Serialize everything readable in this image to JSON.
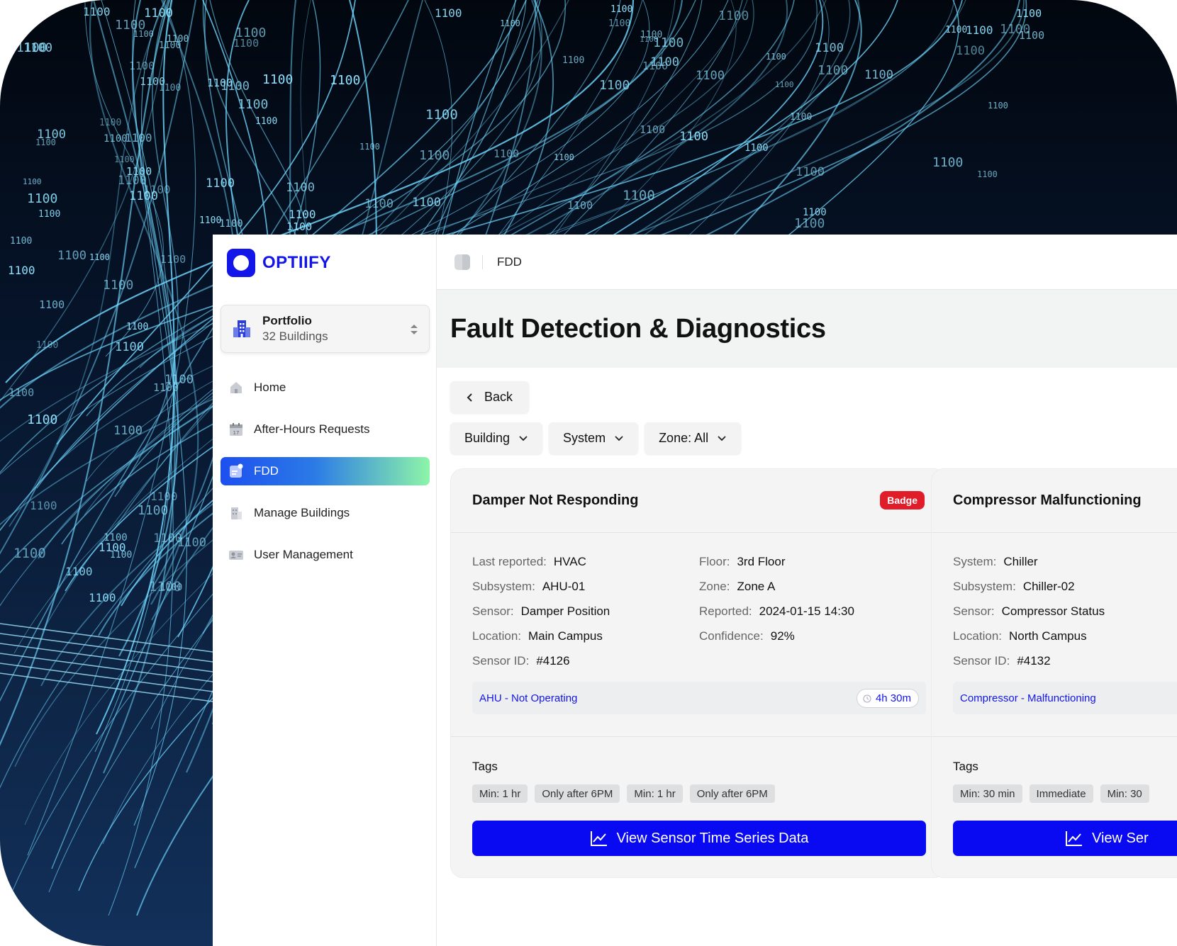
{
  "brand": {
    "name": "OPTIIFY"
  },
  "portfolio": {
    "title": "Portfolio",
    "subtitle": "32 Buildings"
  },
  "nav": {
    "items": [
      {
        "label": "Home",
        "icon": "home-icon",
        "active": false
      },
      {
        "label": "After-Hours Requests",
        "icon": "calendar-icon",
        "active": false
      },
      {
        "label": "FDD",
        "icon": "fdd-icon",
        "active": true
      },
      {
        "label": "Manage Buildings",
        "icon": "building-icon",
        "active": false
      },
      {
        "label": "User Management",
        "icon": "user-card-icon",
        "active": false
      }
    ]
  },
  "topbar": {
    "title": "FDD"
  },
  "page": {
    "title": "Fault Detection & Diagnostics"
  },
  "actions": {
    "back_label": "Back"
  },
  "filters": [
    {
      "label": "Building"
    },
    {
      "label": "System"
    },
    {
      "label": "Zone: All"
    }
  ],
  "cards": [
    {
      "title": "Damper Not Responding",
      "badge": "Badge",
      "left": [
        {
          "label": "Last reported:",
          "value": "HVAC"
        },
        {
          "label": "Subsystem:",
          "value": "AHU-01"
        },
        {
          "label": "Sensor:",
          "value": "Damper Position"
        },
        {
          "label": "Location:",
          "value": "Main Campus"
        },
        {
          "label": "Sensor ID:",
          "value": "#4126"
        }
      ],
      "right": [
        {
          "label": "Floor:",
          "value": "3rd Floor"
        },
        {
          "label": "Zone:",
          "value": "Zone A"
        },
        {
          "label": "Reported:",
          "value": "2024-01-15 14:30"
        },
        {
          "label": "Confidence:",
          "value": "92%"
        }
      ],
      "status": "AHU - Not Operating",
      "duration": "4h 30m",
      "tags_title": "Tags",
      "tags": [
        "Min: 1 hr",
        "Only after 6PM",
        "Min: 1 hr",
        "Only after 6PM"
      ],
      "cta": "View Sensor Time Series Data"
    },
    {
      "title": "Compressor Malfunctioning",
      "left": [
        {
          "label": "System:",
          "value": "Chiller"
        },
        {
          "label": "Subsystem:",
          "value": "Chiller-02"
        },
        {
          "label": "Sensor:",
          "value": "Compressor Status"
        },
        {
          "label": "Location:",
          "value": "North Campus"
        },
        {
          "label": "Sensor ID:",
          "value": "#4132"
        }
      ],
      "status": "Compressor - Malfunctioning",
      "tags_title": "Tags",
      "tags": [
        "Min: 30 min",
        "Immediate",
        "Min: 30"
      ],
      "cta": "View Ser"
    }
  ],
  "backdrop": {
    "binary_text": "1100"
  },
  "colors": {
    "brand": "#1316e8",
    "badge": "#e11d2a",
    "cta": "#0a0af2",
    "backdrop": "#06142a"
  }
}
